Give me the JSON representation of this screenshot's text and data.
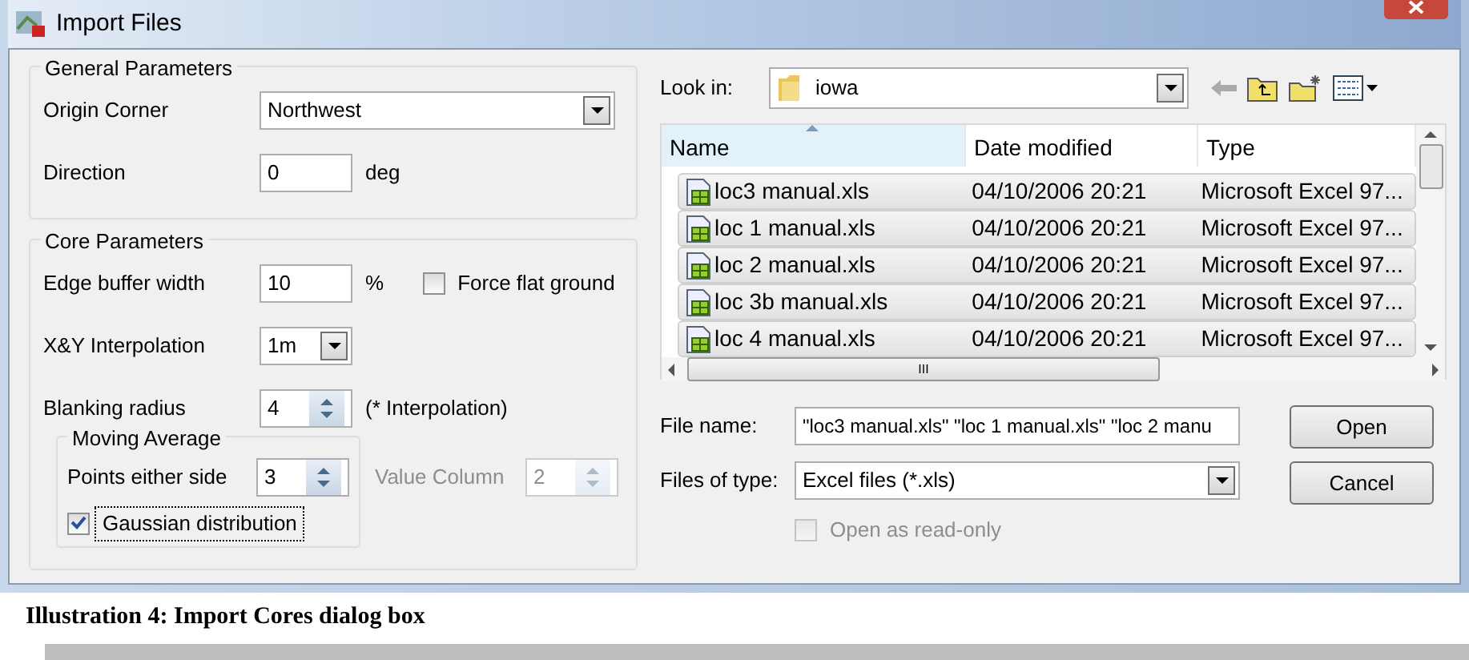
{
  "window": {
    "title": "Import Files"
  },
  "general": {
    "legend": "General Parameters",
    "origin": {
      "label": "Origin Corner",
      "value": "Northwest"
    },
    "direction": {
      "label": "Direction",
      "value": "0",
      "unit": "deg"
    }
  },
  "core": {
    "legend": "Core Parameters",
    "edge": {
      "label": "Edge buffer width",
      "value": "10",
      "unit": "%"
    },
    "force_flat": {
      "label": "Force flat ground",
      "checked": false
    },
    "xy": {
      "label": "X&Y Interpolation",
      "value": "1m"
    },
    "blanking": {
      "label": "Blanking radius",
      "value": "4",
      "note": "(* Interpolation)"
    },
    "moving_average": {
      "legend": "Moving Average",
      "points": {
        "label": "Points either side",
        "value": "3"
      },
      "value_column": {
        "label": "Value Column",
        "value": "2",
        "disabled": true
      },
      "gaussian": {
        "label": "Gaussian distribution",
        "checked": true,
        "focused": true
      }
    }
  },
  "browser": {
    "look_in": {
      "label": "Look in:",
      "value": "iowa"
    },
    "columns": [
      {
        "label": "Name",
        "sorted": true
      },
      {
        "label": "Date modified",
        "sorted": false
      },
      {
        "label": "Type",
        "sorted": false
      }
    ],
    "rows": [
      {
        "name": "loc3 manual.xls",
        "date": "04/10/2006 20:21",
        "type": "Microsoft Excel 97...",
        "selected": true
      },
      {
        "name": "loc 1 manual.xls",
        "date": "04/10/2006 20:21",
        "type": "Microsoft Excel 97...",
        "selected": true
      },
      {
        "name": "loc 2 manual.xls",
        "date": "04/10/2006 20:21",
        "type": "Microsoft Excel 97...",
        "selected": true
      },
      {
        "name": "loc 3b manual.xls",
        "date": "04/10/2006 20:21",
        "type": "Microsoft Excel 97...",
        "selected": true
      },
      {
        "name": "loc 4 manual.xls",
        "date": "04/10/2006 20:21",
        "type": "Microsoft Excel 97...",
        "selected": true
      }
    ],
    "scrollbar_label": "III",
    "file_name": {
      "label": "File name:",
      "value": "\"loc3 manual.xls\" \"loc 1 manual.xls\" \"loc 2 manu"
    },
    "file_type": {
      "label": "Files of type:",
      "value": "Excel files (*.xls)"
    },
    "read_only": {
      "label": "Open as read-only",
      "checked": false,
      "disabled": true
    },
    "buttons": [
      "Open",
      "Cancel"
    ]
  },
  "caption": "Illustration 4: Import Cores dialog box"
}
